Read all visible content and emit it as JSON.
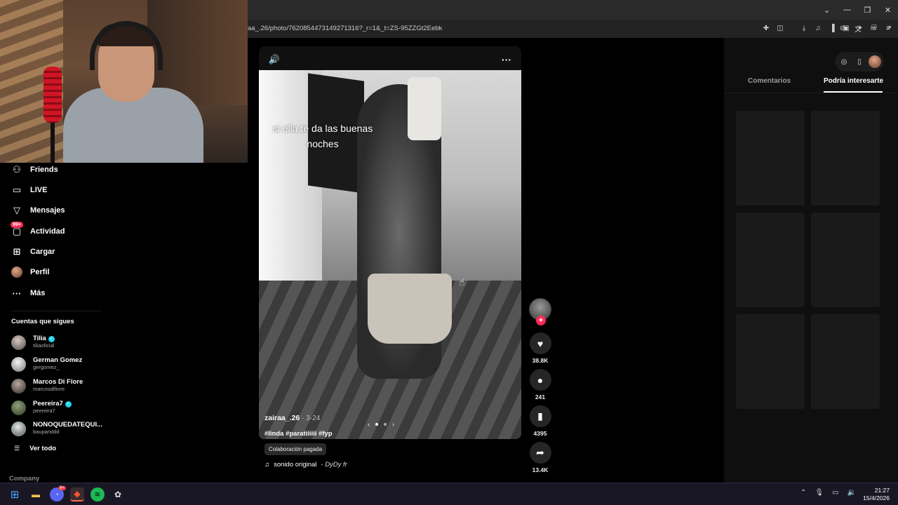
{
  "browser": {
    "url": "aa_.26/photo/7620854473149271316?_r=1&_t=ZS-95ZZGt2Eebk",
    "window_controls": [
      "⌄",
      "—",
      "❐",
      "✕"
    ],
    "url_icons": [
      "reader-mode-icon",
      "translate-icon",
      "cast-icon",
      "share-icon",
      "brave-shield-icon",
      "brave-rewards-icon"
    ],
    "toolbar_icons": [
      "extensions-icon",
      "screenshot-icon",
      "download-icon",
      "media-icon",
      "sidebar-icon",
      "wallet-icon",
      "leo-ai-icon",
      "vpn-icon",
      "menu-icon"
    ]
  },
  "sidebar": {
    "nav": [
      {
        "label": "Friends",
        "icon": "friends-icon"
      },
      {
        "label": "LIVE",
        "icon": "live-icon"
      },
      {
        "label": "Mensajes",
        "icon": "messages-icon"
      },
      {
        "label": "Actividad",
        "icon": "activity-icon",
        "badge": "99+"
      },
      {
        "label": "Cargar",
        "icon": "upload-icon"
      },
      {
        "label": "Perfil",
        "icon": "profile-avatar"
      },
      {
        "label": "Más",
        "icon": "more-icon"
      }
    ],
    "following_heading": "Cuentas que sigues",
    "following": [
      {
        "name": "Tilia",
        "handle": "tiliaoficial",
        "verified": true
      },
      {
        "name": "German Gomez",
        "handle": "gergomez_",
        "verified": false
      },
      {
        "name": "Marcos Di Fiore",
        "handle": "marcosdifiore",
        "verified": false
      },
      {
        "name": "Peereira7",
        "handle": "peereira7",
        "verified": true
      },
      {
        "name": "NONOQUEDATEQUI...",
        "handle": "baupanddd",
        "verified": false
      }
    ],
    "see_all": "Ver todo",
    "company": "Company"
  },
  "video": {
    "overlay_text_line1": "si ella te da las buenas",
    "overlay_text_line2": "noches",
    "username": "zairaa_.26",
    "date": "· 3-24",
    "hashtags": "#linda #paratiiiiii #fyp",
    "paid_label": "Colaboración pagada",
    "sound_name": "sonido original",
    "sound_artist": "- DyDy fr",
    "carousel_total": 2,
    "carousel_current": 1
  },
  "actions": {
    "likes": "38.8K",
    "comments": "241",
    "saves": "4395",
    "shares": "13.4K"
  },
  "right_panel": {
    "tab_comments": "Comentarios",
    "tab_suggested": "Podría interesarte",
    "tiles": 6
  },
  "taskbar": {
    "time": "21:27",
    "date": "15/4/2026",
    "discord_badge": "9+"
  },
  "colors": {
    "accent": "#fe2c55",
    "verified": "#20d5ec",
    "taskbar": "#1a1724"
  }
}
